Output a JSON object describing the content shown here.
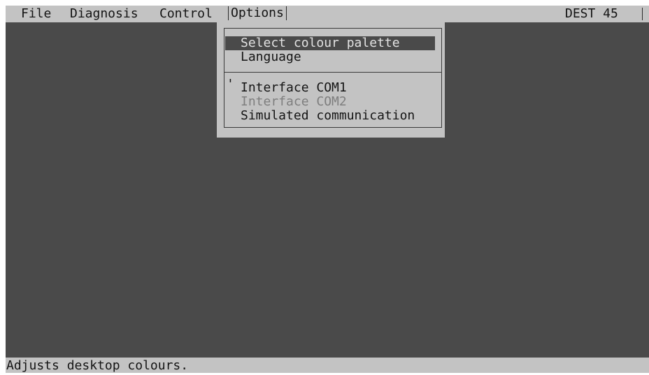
{
  "menubar": {
    "items": [
      {
        "label": "File"
      },
      {
        "label": "Diagnosis"
      },
      {
        "label": "Control"
      },
      {
        "label": "Options"
      }
    ],
    "dest_label": "DEST 45"
  },
  "options_menu": {
    "items": [
      {
        "label": "Select colour palette",
        "selected": true
      },
      {
        "label": "Language"
      },
      {
        "label": "Interface COM1",
        "checked": true,
        "check_mark": "'"
      },
      {
        "label": "Interface COM2",
        "disabled": true
      },
      {
        "label": "Simulated communication"
      }
    ]
  },
  "status": {
    "text": "Adjusts desktop colours."
  },
  "colors": {
    "desktop": "#4a4a4a",
    "bar": "#c3c3c3",
    "text": "#141414",
    "highlight_bg": "#4a4a4a",
    "highlight_text": "#e2e2e2",
    "disabled_text": "#7e7e7e"
  }
}
